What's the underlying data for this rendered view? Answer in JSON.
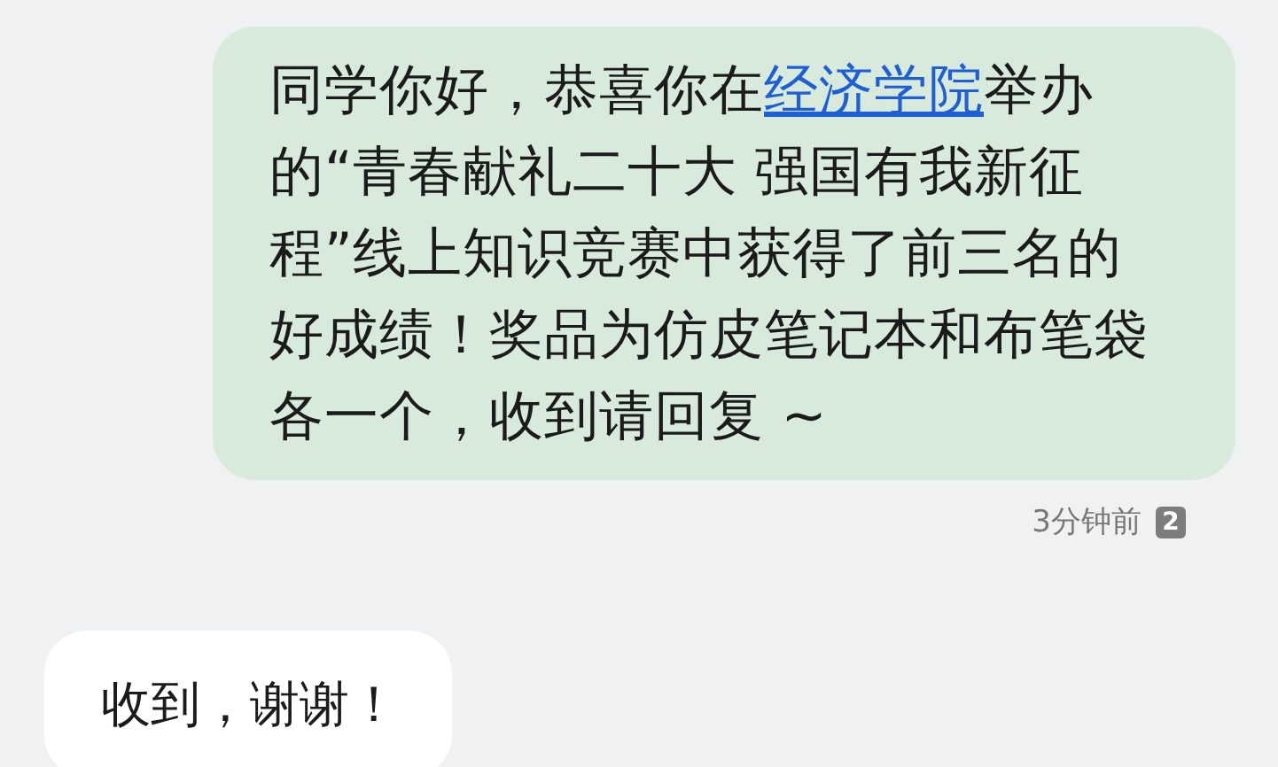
{
  "messages": [
    {
      "outgoing": true,
      "segments": [
        {
          "text": "同学你好，恭喜你在"
        },
        {
          "text": "经济学院",
          "link": true
        },
        {
          "text": "举办的“青春献礼二十大 强国有我新征程”线上知识竞赛中获得了前三名的好成绩！奖品为仿皮笔记本和布笔袋各一个，收到请回复 ~"
        }
      ],
      "time": "3分钟前",
      "read_count": "2"
    },
    {
      "outgoing": false,
      "segments": [
        {
          "text": "收到，谢谢！"
        }
      ]
    }
  ]
}
